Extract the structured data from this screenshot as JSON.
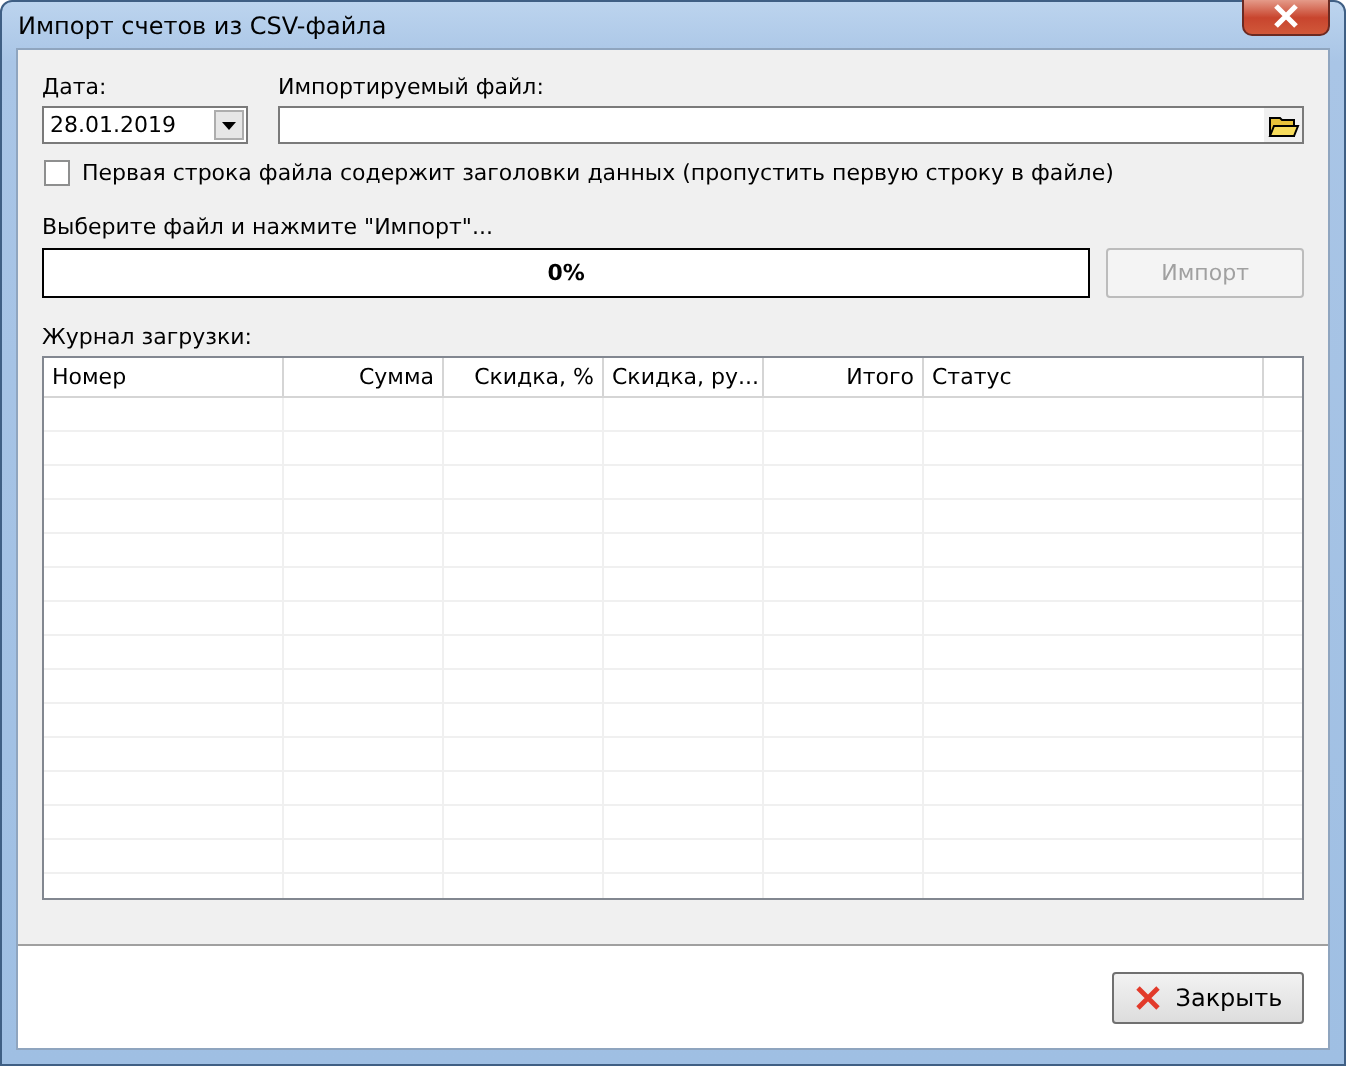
{
  "window": {
    "title": "Импорт счетов из CSV-файла"
  },
  "date": {
    "label": "Дата:",
    "value": "28.01.2019"
  },
  "file": {
    "label": "Импортируемый файл:"
  },
  "header_row_option": {
    "label": "Первая строка файла содержит заголовки данных (пропустить первую строку в файле)",
    "checked": false
  },
  "status_text": "Выберите файл и нажмите \"Импорт\"...",
  "progress": {
    "level": 0,
    "reading": "0%"
  },
  "import_button": {
    "label": "Импорт",
    "disabled": true
  },
  "log": {
    "label": "Журнал загрузки:",
    "columns": [
      {
        "label": "Номер",
        "kind": "text"
      },
      {
        "label": "Сумма",
        "kind": "number"
      },
      {
        "label": "Скидка, %",
        "kind": "number"
      },
      {
        "label": "Скидка, ру...",
        "kind": "number"
      },
      {
        "label": "Итого",
        "kind": "number"
      },
      {
        "label": "Статус",
        "kind": "text"
      }
    ]
  },
  "close_button": {
    "label": "Закрыть"
  }
}
